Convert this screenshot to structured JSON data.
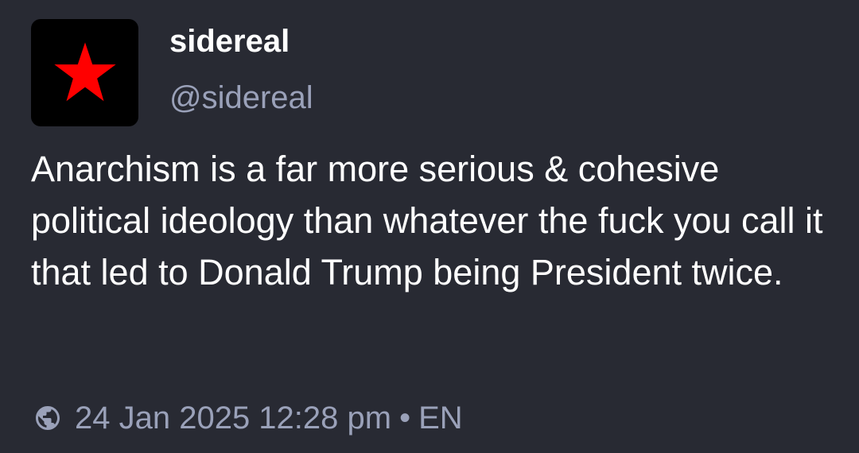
{
  "author": {
    "display_name": "sidereal",
    "handle": "@sidereal",
    "avatar_icon": "red-star-icon",
    "avatar_background": "#000000",
    "avatar_star_color": "#ff0000"
  },
  "post": {
    "text": "Anarchism is a far more serious & cohesive political ideology than whatever the fuck you call it that led to Donald Trump being President twice."
  },
  "meta": {
    "visibility_icon": "globe-icon",
    "timestamp": "24 Jan 2025 12:28 pm",
    "separator": "•",
    "language": "EN"
  },
  "colors": {
    "background": "#282a33",
    "primary_text": "#ffffff",
    "secondary_text": "#9aa1b9"
  }
}
